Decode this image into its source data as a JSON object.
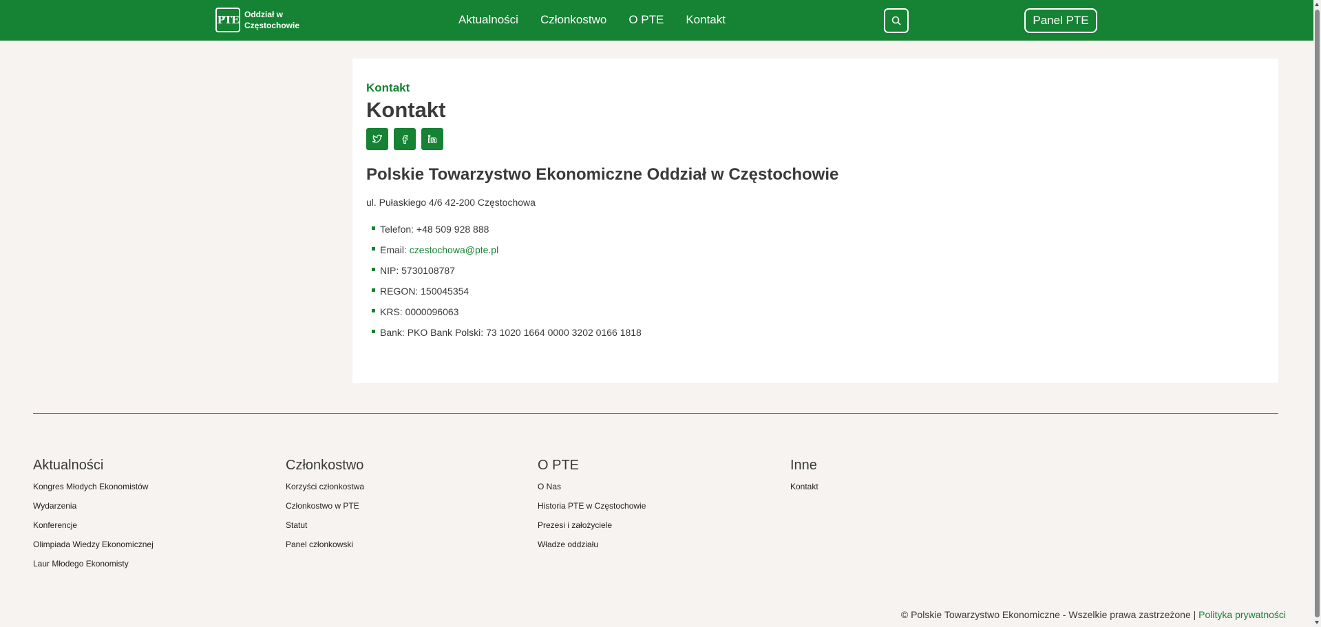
{
  "header": {
    "logo_mark": "PTE",
    "logo_line1": "Oddział w",
    "logo_line2": "Częstochowie",
    "nav": [
      "Aktualności",
      "Członkostwo",
      "O PTE",
      "Kontakt"
    ],
    "search_icon": "search-icon",
    "panel_label": "Panel PTE",
    "background_color": "#168233"
  },
  "main": {
    "breadcrumb": "Kontakt",
    "title": "Kontakt",
    "social_icons": [
      "twitter-icon",
      "facebook-icon",
      "linkedin-icon"
    ],
    "org_name": "Polskie Towarzystwo Ekonomiczne Oddział w Częstochowie",
    "address": "ul. Pułaskiego 4/6 42-200 Częstochowa",
    "phone": "Telefon: +48 509 928 888",
    "email_label": "Email: ",
    "email": "czestochowa@pte.pl",
    "nip": "NIP: 5730108787",
    "regon": "REGON: 150045354",
    "krs": "KRS: 0000096063",
    "bank": "Bank: PKO Bank Polski: 73 1020 1664 0000 3202 0166 1818"
  },
  "footer": {
    "columns": [
      {
        "title": "Aktualności",
        "links": [
          "Kongres Młodych Ekonomistów",
          "Wydarzenia",
          "Konferencje",
          "Olimpiada Wiedzy Ekonomicznej",
          "Laur Młodego Ekonomisty"
        ]
      },
      {
        "title": "Członkostwo",
        "links": [
          "Korzyści członkostwa",
          "Członkostwo w PTE",
          "Statut",
          "Panel członkowski"
        ]
      },
      {
        "title": "O PTE",
        "links": [
          "O Nas",
          "Historia PTE w Częstochowie",
          "Prezesi i założyciele",
          "Władze oddziału"
        ]
      },
      {
        "title": "Inne",
        "links": [
          "Kontakt"
        ]
      }
    ],
    "copyright": "© Polskie Towarzystwo Ekonomiczne - Wszelkie prawa zastrzeżone | ",
    "privacy_link": "Polityka prywatności"
  },
  "accent_color": "#168233",
  "page_background": "#f6f3f0"
}
